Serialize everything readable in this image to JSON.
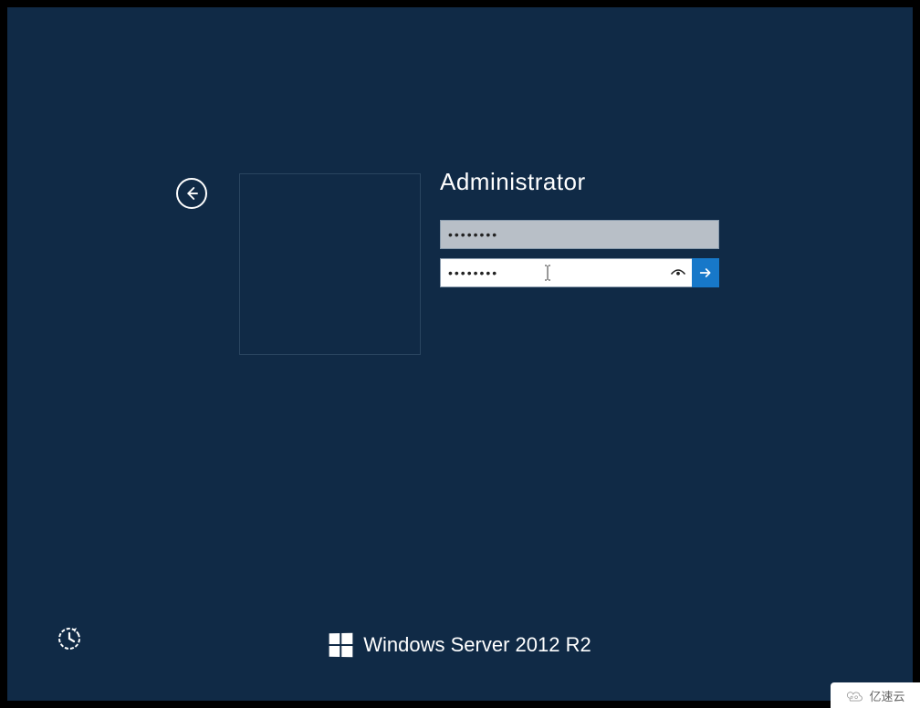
{
  "login": {
    "username": "Administrator",
    "password_top_value": "••••••••",
    "password_bottom_value": "••••••••"
  },
  "branding": {
    "product": "Windows Server",
    "year": "2012",
    "edition": "R2"
  },
  "watermark": {
    "text": "亿速云"
  },
  "colors": {
    "background": "#102a46",
    "accent": "#1778c9",
    "input_disabled": "#b8bfc7"
  }
}
